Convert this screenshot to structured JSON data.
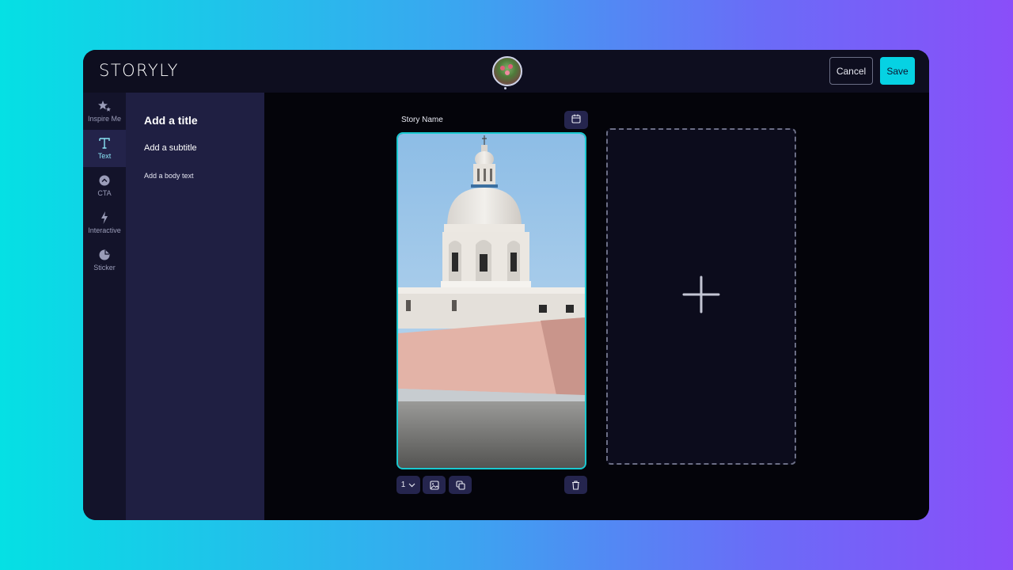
{
  "app": {
    "logo": "STORYLY"
  },
  "header": {
    "cancel_label": "Cancel",
    "save_label": "Save"
  },
  "rail": {
    "items": [
      {
        "label": "Inspire Me",
        "icon": "sparkle-star-icon",
        "active": false
      },
      {
        "label": "Text",
        "icon": "text-t-icon",
        "active": true
      },
      {
        "label": "CTA",
        "icon": "chevron-up-circle-icon",
        "active": false
      },
      {
        "label": "Interactive",
        "icon": "lightning-icon",
        "active": false
      },
      {
        "label": "Sticker",
        "icon": "sticker-icon",
        "active": false
      }
    ]
  },
  "text_panel": {
    "title": "Add a title",
    "subtitle": "Add a subtitle",
    "body": "Add a body text"
  },
  "canvas": {
    "story_name": "Story Name",
    "page_selector_value": "1"
  },
  "colors": {
    "accent": "#06d2e3",
    "window_bg": "#04040a",
    "topbar_bg": "#0e0e1f",
    "panel_bg": "#1f1f42",
    "rail_bg": "#13132a",
    "control_bg": "#25254e"
  }
}
